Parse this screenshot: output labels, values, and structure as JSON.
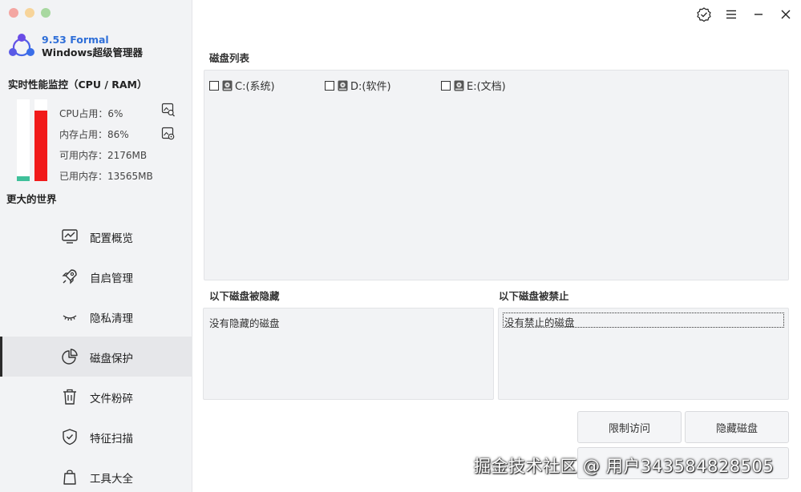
{
  "brand": {
    "version": "9.53 Formal",
    "name": "Windows超级管理器",
    "accent": "#2f6fd8"
  },
  "perf": {
    "title": "实时性能监控（CPU / RAM）",
    "cpu_percent": 6,
    "mem_percent": 86,
    "cpu_color": "#3fc09a",
    "mem_color": "#f11a1a",
    "cpu": "CPU占用：6%",
    "mem": "内存占用：86%",
    "avail": "可用内存：2176MB",
    "used": "已用内存：13565MB"
  },
  "sidebar": {
    "world": "更大的世界",
    "items": [
      {
        "label": "配置概览",
        "icon": "monitor-chart-icon"
      },
      {
        "label": "自启管理",
        "icon": "rocket-icon"
      },
      {
        "label": "隐私清理",
        "icon": "closed-eye-icon"
      },
      {
        "label": "磁盘保护",
        "icon": "pie-chart-icon",
        "active": true
      },
      {
        "label": "文件粉碎",
        "icon": "trash-icon"
      },
      {
        "label": "特征扫描",
        "icon": "shield-check-icon"
      },
      {
        "label": "工具大全",
        "icon": "bag-icon"
      }
    ]
  },
  "main": {
    "disk_list_title": "磁盘列表",
    "disks": [
      {
        "label": "C:(系统)",
        "checked": false
      },
      {
        "label": "D:(软件)",
        "checked": false
      },
      {
        "label": "E:(文档)",
        "checked": false
      }
    ],
    "hidden_title": "以下磁盘被隐藏",
    "hidden_empty": "没有隐藏的磁盘",
    "banned_title": "以下磁盘被禁止",
    "banned_empty": "没有禁止的磁盘",
    "buttons": {
      "restrict": "限制访问",
      "hide": "隐藏磁盘",
      "third": ""
    }
  },
  "watermark": "掘金技术社区 @ 用户343584828505"
}
